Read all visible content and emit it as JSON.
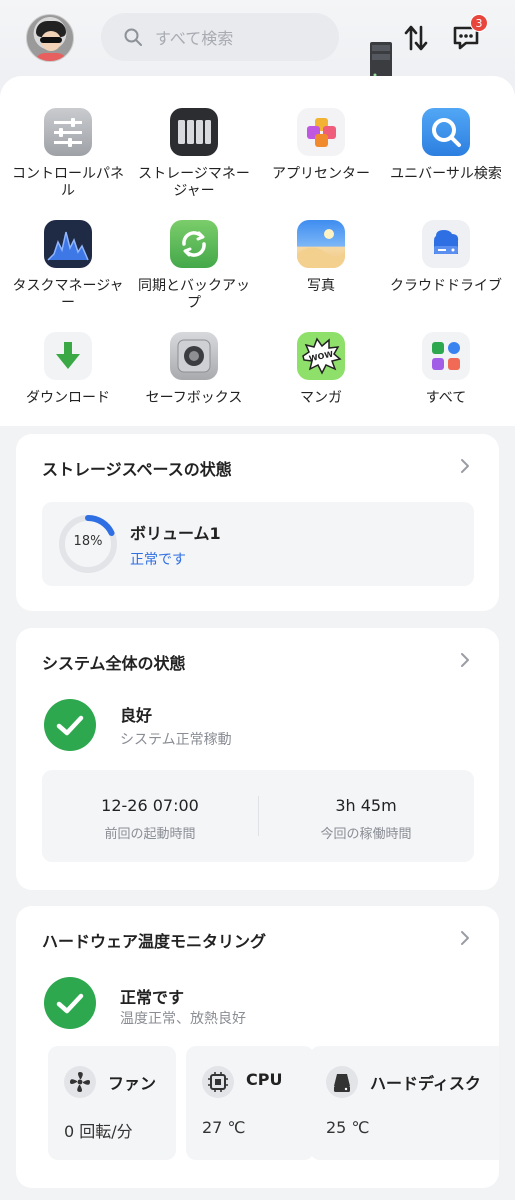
{
  "header": {
    "search_placeholder": "すべて検索",
    "notification_count": "3"
  },
  "apps": [
    {
      "label": "コントロールパネル",
      "icon": "control-panel-icon"
    },
    {
      "label": "ストレージマネージャー",
      "icon": "storage-manager-icon"
    },
    {
      "label": "アプリセンター",
      "icon": "app-center-icon"
    },
    {
      "label": "ユニバーサル検索",
      "icon": "universal-search-icon"
    },
    {
      "label": "タスクマネージャー",
      "icon": "task-manager-icon"
    },
    {
      "label": "同期とバックアップ",
      "icon": "sync-backup-icon"
    },
    {
      "label": "写真",
      "icon": "photos-icon"
    },
    {
      "label": "クラウドドライブ",
      "icon": "cloud-drive-icon"
    },
    {
      "label": "ダウンロード",
      "icon": "download-icon"
    },
    {
      "label": "セーフボックス",
      "icon": "safebox-icon"
    },
    {
      "label": "マンガ",
      "icon": "manga-icon"
    },
    {
      "label": "すべて",
      "icon": "all-apps-icon"
    }
  ],
  "storage": {
    "title": "ストレージスペースの状態",
    "volume_name": "ボリューム1",
    "usage_percent_label": "18%",
    "usage_fraction": 0.18,
    "status": "正常です",
    "accent": "#2f6fe4"
  },
  "system": {
    "title": "システム全体の状態",
    "status": "良好",
    "status_sub": "システム正常稼動",
    "last_boot_value": "12-26 07:00",
    "last_boot_label": "前回の起動時間",
    "uptime_value": "3h 45m",
    "uptime_label": "今回の稼働時間"
  },
  "hardware": {
    "title": "ハードウェア温度モニタリング",
    "status": "正常です",
    "status_sub": "温度正常、放熱良好",
    "fan_name": "ファン",
    "fan_value": "0 回転/分",
    "cpu_name": "CPU",
    "cpu_value": "27 ℃",
    "disk_name": "ハードディスク",
    "disk_value": "25 ℃",
    "ok_color": "#2ea84f"
  }
}
